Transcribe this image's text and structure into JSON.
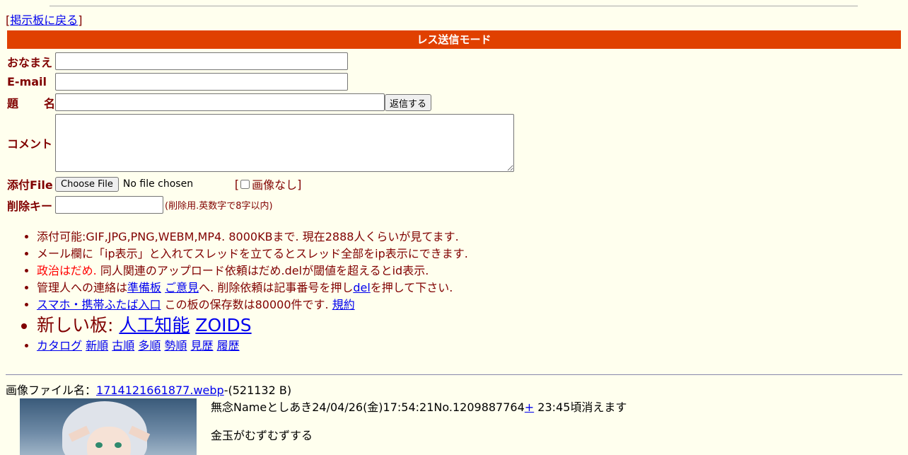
{
  "nav": {
    "back_open": "[",
    "back_label": "掲示板に戻る",
    "back_close": "]"
  },
  "mode_title": "レス送信モード",
  "form": {
    "name_label_1": "おなまえ",
    "email_label": "E-mail",
    "subject_label_a": "題",
    "subject_label_b": "名",
    "submit_label": "返信する",
    "comment_label": "コメント",
    "file_label": "添付File",
    "file_button": "Choose File",
    "file_status": "No file chosen",
    "noimg_open": "[",
    "noimg_label": "画像なし",
    "noimg_close": "]",
    "delkey_label": "削除キー",
    "delkey_note": "(削除用.英数字で8字以内)"
  },
  "info": {
    "line1": "添付可能:GIF,JPG,PNG,WEBM,MP4. 8000KBまで. 現在2888人くらいが見てます.",
    "line2": "メール欄に「ip表示」と入れてスレッドを立てるとスレッド全部をip表示にできます.",
    "line3_red": "政治はだめ.",
    "line3_rest": " 同人関連のアップロード依頼はだめ.delが閾値を超えるとid表示.",
    "line4_a": "管理人への連絡は",
    "line4_link1": "準備板",
    "line4_link2": "ご意見",
    "line4_b": "へ. 削除依頼は記事番号を押し",
    "line4_link3": "del",
    "line4_c": "を押して下さい.",
    "line5_link1": "スマホ・携帯ふたば入口",
    "line5_b": " この板の保存数は80000件です. ",
    "line5_link2": "規約",
    "line6_text": "新しい板: ",
    "line6_link1": "人工知能",
    "line6_link2": "ZOIDS",
    "sort_links": [
      "カタログ",
      "新順",
      "古順",
      "多順",
      "勢順",
      "見歴",
      "履歴"
    ]
  },
  "post": {
    "file_prefix": "画像ファイル名：",
    "file_name": "1714121661877.webp",
    "file_size": "-(521132 B)",
    "header": "無念Nameとしあき24/04/26(金)17:54:21No.1209887764",
    "plus": "+",
    "expire": " 23:45頃消えます",
    "body": "金玉がむずむずする"
  }
}
